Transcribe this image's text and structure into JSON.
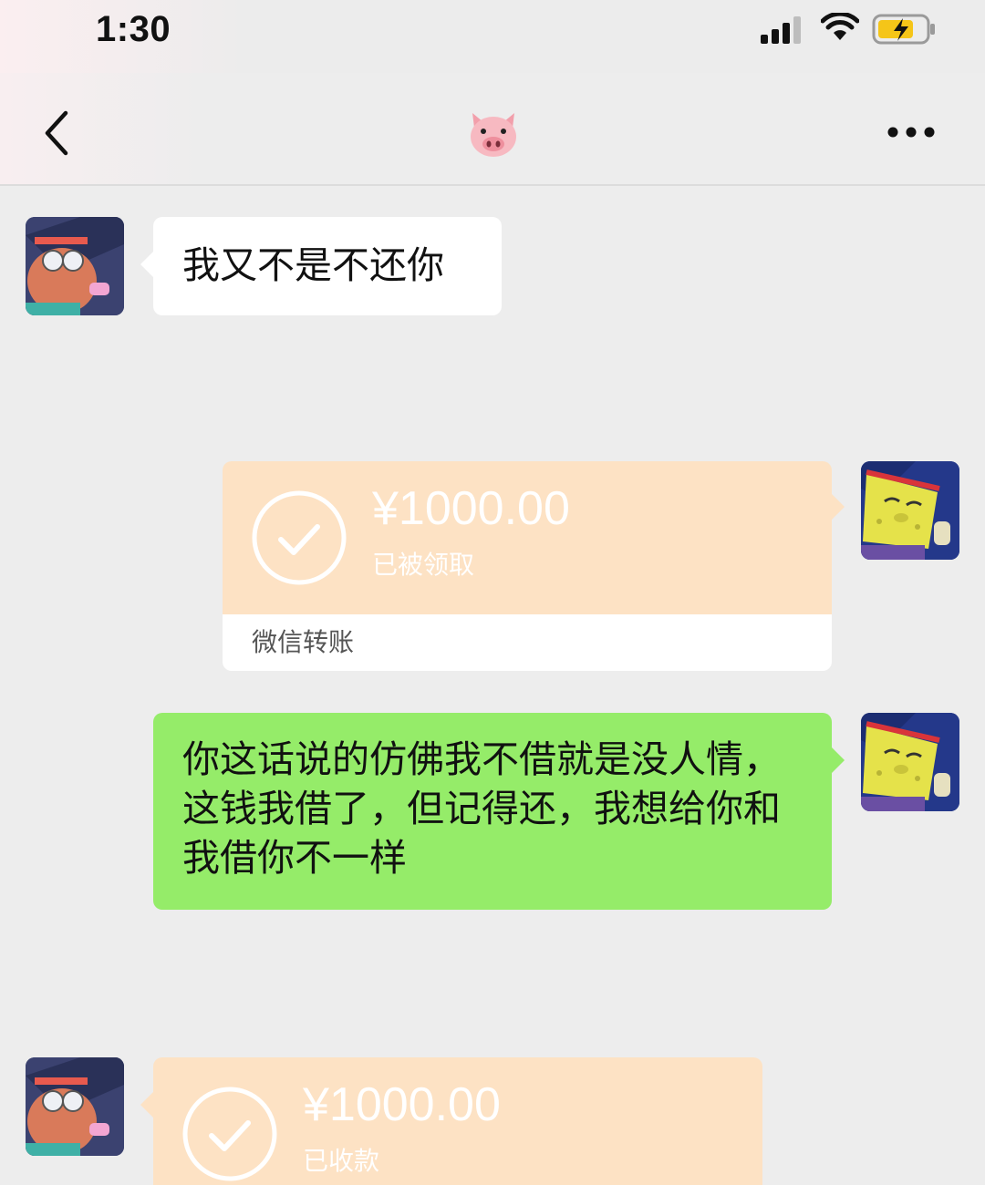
{
  "status_bar": {
    "time": "1:30",
    "icons": [
      "signal-icon",
      "wifi-icon",
      "battery-charging-icon"
    ]
  },
  "nav": {
    "back_icon": "chevron-left-icon",
    "title_icon": "pig-face-emoji",
    "more_icon": "more-dots-icon"
  },
  "messages": [
    {
      "side": "left",
      "type": "text",
      "text": "我又不是不还你"
    },
    {
      "side": "right",
      "type": "transfer",
      "amount": "¥1000.00",
      "status": "已被领取",
      "footer": "微信转账"
    },
    {
      "side": "right",
      "type": "text",
      "text": "你这话说的仿佛我不借就是没人情，这钱我借了，但记得还，我想给你和我借你不一样"
    },
    {
      "side": "left",
      "type": "transfer",
      "amount": "¥1000.00",
      "status": "已收款"
    }
  ],
  "colors": {
    "background": "#ededed",
    "incoming_bubble": "#ffffff",
    "outgoing_bubble": "#95ec69",
    "transfer_card": "#fde2c4"
  }
}
